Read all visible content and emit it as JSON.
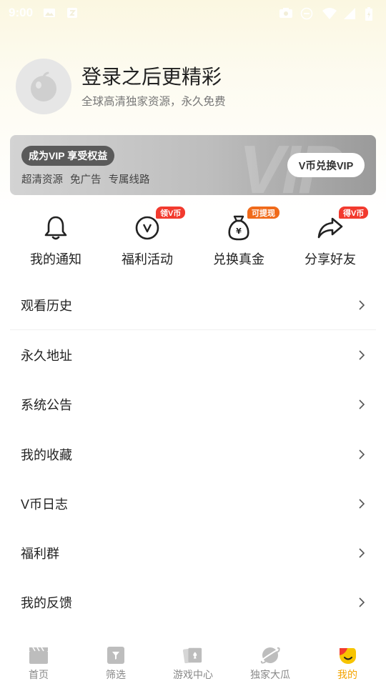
{
  "status_bar": {
    "time": "9:00",
    "icons": [
      "image-icon",
      "notification-icon",
      "camera-icon",
      "dnd-icon",
      "wifi-icon",
      "signal-icon",
      "battery-icon"
    ]
  },
  "profile": {
    "title": "登录之后更精彩",
    "subtitle": "全球高清独家资源，永久免费"
  },
  "vip_banner": {
    "tag": "成为VIP 享受权益",
    "perks": [
      "超清资源",
      "免广告",
      "专属线路"
    ],
    "button_label": "V币兑换VIP"
  },
  "quick_actions": [
    {
      "label": "我的通知",
      "icon": "bell-icon",
      "badge": ""
    },
    {
      "label": "福利活动",
      "icon": "v-coin-icon",
      "badge": "领V币"
    },
    {
      "label": "兑换真金",
      "icon": "money-bag-icon",
      "badge": "可提现"
    },
    {
      "label": "分享好友",
      "icon": "share-icon",
      "badge": "得V币"
    }
  ],
  "menu": [
    "观看历史",
    "永久地址",
    "系统公告",
    "我的收藏",
    "V币日志",
    "福利群",
    "我的反馈"
  ],
  "tabs": [
    {
      "label": "首页",
      "icon": "clapperboard-icon"
    },
    {
      "label": "筛选",
      "icon": "filter-icon"
    },
    {
      "label": "游戏中心",
      "icon": "cards-icon"
    },
    {
      "label": "独家大瓜",
      "icon": "planet-icon"
    },
    {
      "label": "我的",
      "icon": "profile-face-icon"
    }
  ],
  "colors": {
    "accent": "#f4a400",
    "badge_red": "#f23a2e",
    "badge_orange": "#f06a1a",
    "tab_inactive": "#888888"
  }
}
